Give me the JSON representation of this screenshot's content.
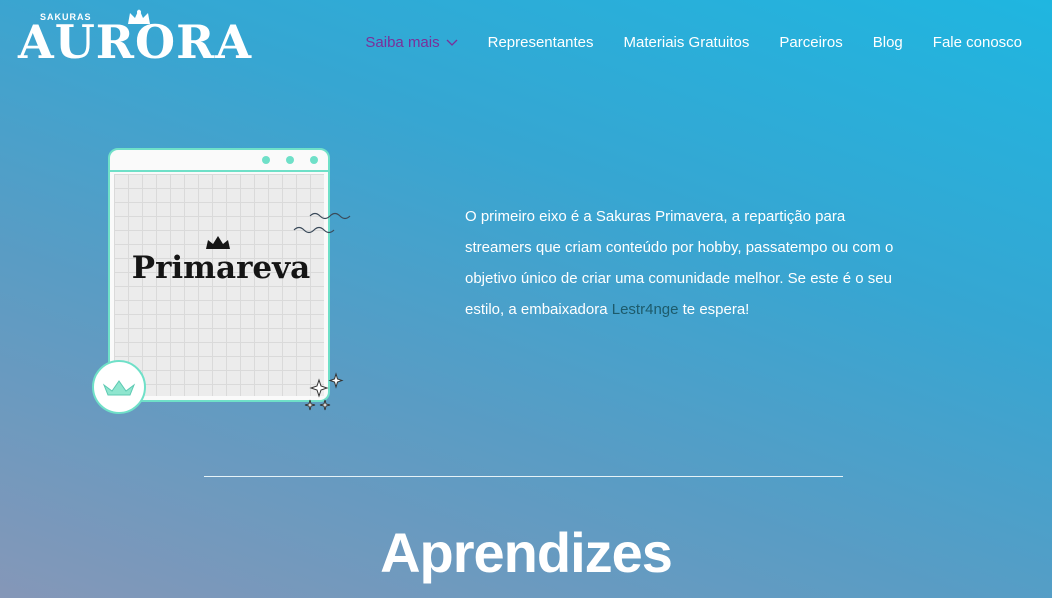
{
  "header": {
    "logo": {
      "small_text": "SAKURAS",
      "main_text": "AURORA"
    },
    "nav": [
      {
        "label": "Saiba mais",
        "active": true,
        "has_dropdown": true
      },
      {
        "label": "Representantes"
      },
      {
        "label": "Materiais Gratuitos"
      },
      {
        "label": "Parceiros"
      },
      {
        "label": "Blog"
      },
      {
        "label": "Fale conosco"
      }
    ]
  },
  "feature": {
    "card_title": "Primareva",
    "text_before_link": "O primeiro eixo é a Sakuras Primavera, a repartição para streamers que criam conteúdo por hobby, passatempo ou com o objetivo único de criar uma comunidade melhor. Se este é o seu estilo, a embaixadora ",
    "link_text": "Lestr4nge",
    "text_after_link": " te espera!"
  },
  "section": {
    "title": "Aprendizes"
  },
  "colors": {
    "accent_mint": "#6fe0c8",
    "active_nav": "#7b2f9a",
    "link": "#1d5b6b"
  },
  "icons": [
    "crown-icon",
    "chevron-down-icon",
    "boat-icon",
    "sparkle-icon",
    "wave-icon"
  ]
}
